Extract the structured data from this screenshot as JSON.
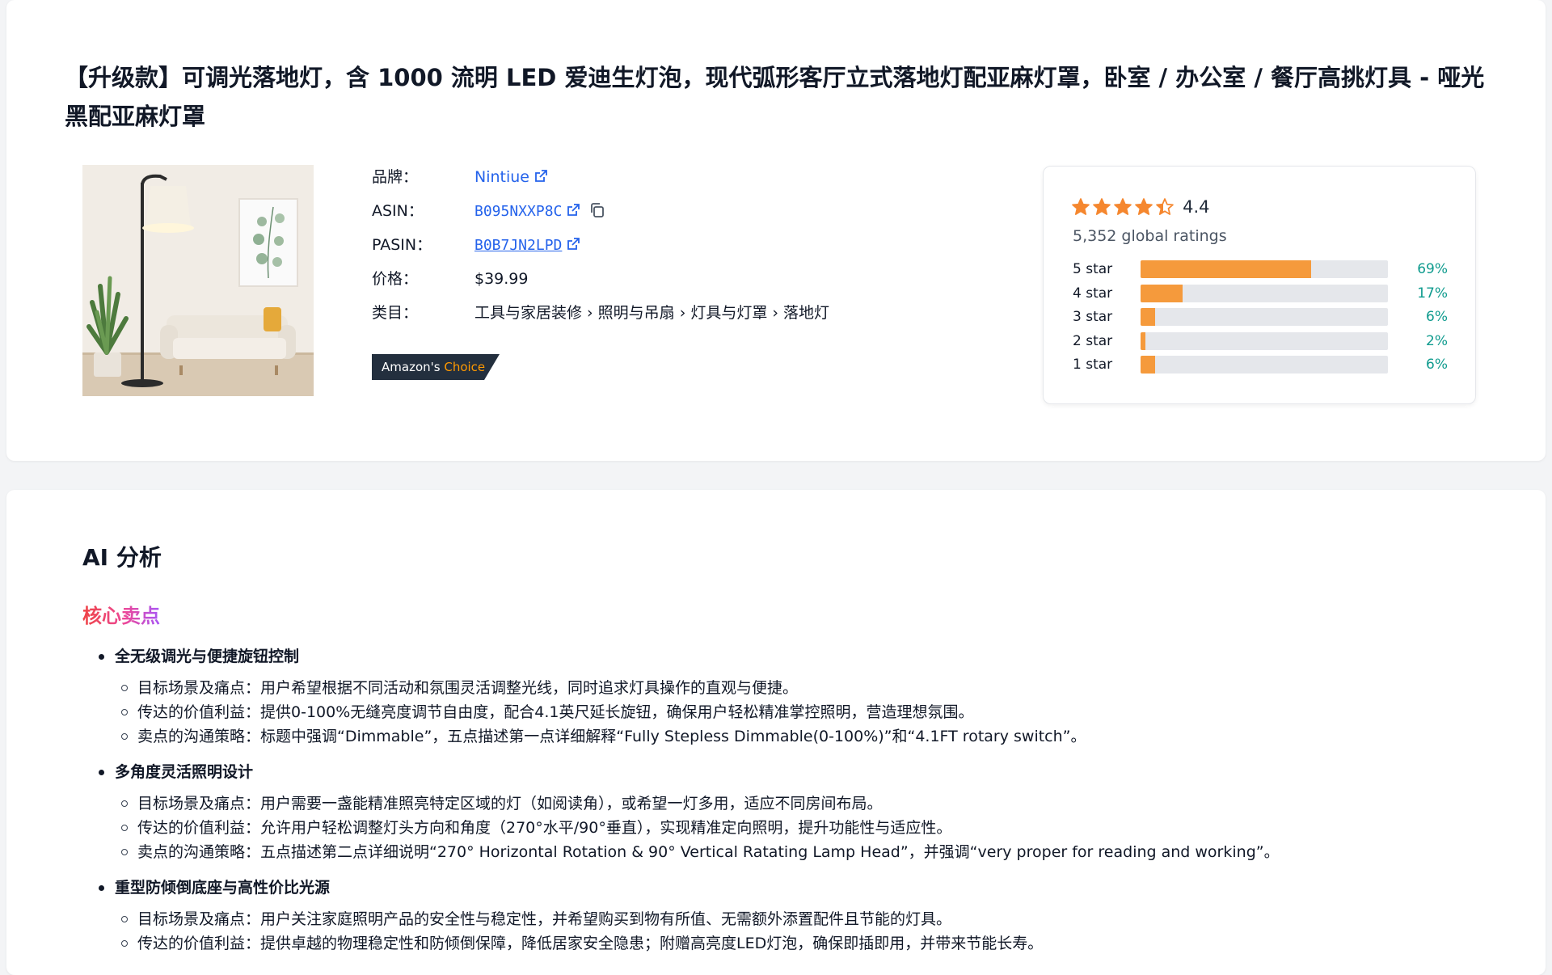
{
  "product": {
    "title": "【升级款】可调光落地灯，含 1000 流明 LED 爱迪生灯泡，现代弧形客厅立式落地灯配亚麻灯罩，卧室 / 办公室 / 餐厅高挑灯具 - 哑光黑配亚麻灯罩",
    "image_alt": "落地灯产品图",
    "brand_label": "品牌：",
    "brand": "Nintiue",
    "asin_label": "ASIN：",
    "asin": "B095NXXP8C",
    "pasin_label": "PASIN：",
    "pasin": "B0B7JN2LPD",
    "price_label": "价格：",
    "price": "$39.99",
    "category_label": "类目：",
    "category": "工具与家居装修 › 照明与吊扇 › 灯具与灯罩 › 落地灯",
    "badge_prefix": "Amazon's",
    "badge_suffix": "Choice",
    "icons": {
      "external": "external-link-icon",
      "copy": "copy-icon"
    }
  },
  "ratings": {
    "average": "4.4",
    "average_value": 4.4,
    "global_text": "5,352 global ratings",
    "star_color": "#f5872f",
    "bar_color": "#f59a3c",
    "pct_color": "#0f9b8e",
    "histogram": [
      {
        "label": "5 star",
        "pct": "69%",
        "value": 69
      },
      {
        "label": "4 star",
        "pct": "17%",
        "value": 17
      },
      {
        "label": "3 star",
        "pct": "6%",
        "value": 6
      },
      {
        "label": "2 star",
        "pct": "2%",
        "value": 2
      },
      {
        "label": "1 star",
        "pct": "6%",
        "value": 6
      }
    ]
  },
  "ai": {
    "title": "AI 分析",
    "subtitle": "核心卖点",
    "sections": [
      {
        "heading": "全无级调光与便捷旋钮控制",
        "items": [
          "目标场景及痛点：用户希望根据不同活动和氛围灵活调整光线，同时追求灯具操作的直观与便捷。",
          "传达的价值利益：提供0-100%无缝亮度调节自由度，配合4.1英尺延长旋钮，确保用户轻松精准掌控照明，营造理想氛围。",
          "卖点的沟通策略：标题中强调“Dimmable”，五点描述第一点详细解释“Fully Stepless Dimmable(0-100%)”和“4.1FT rotary switch”。"
        ]
      },
      {
        "heading": "多角度灵活照明设计",
        "items": [
          "目标场景及痛点：用户需要一盏能精准照亮特定区域的灯（如阅读角），或希望一灯多用，适应不同房间布局。",
          "传达的价值利益：允许用户轻松调整灯头方向和角度（270°水平/90°垂直），实现精准定向照明，提升功能性与适应性。",
          "卖点的沟通策略：五点描述第二点详细说明“270° Horizontal Rotation & 90° Vertical Ratating Lamp Head”，并强调“very proper for reading and working”。"
        ]
      },
      {
        "heading": "重型防倾倒底座与高性价比光源",
        "items": [
          "目标场景及痛点：用户关注家庭照明产品的安全性与稳定性，并希望购买到物有所值、无需额外添置配件且节能的灯具。",
          "传达的价值利益：提供卓越的物理稳定性和防倾倒保障，降低居家安全隐患；附赠高亮度LED灯泡，确保即插即用，并带来节能长寿。"
        ]
      }
    ]
  }
}
